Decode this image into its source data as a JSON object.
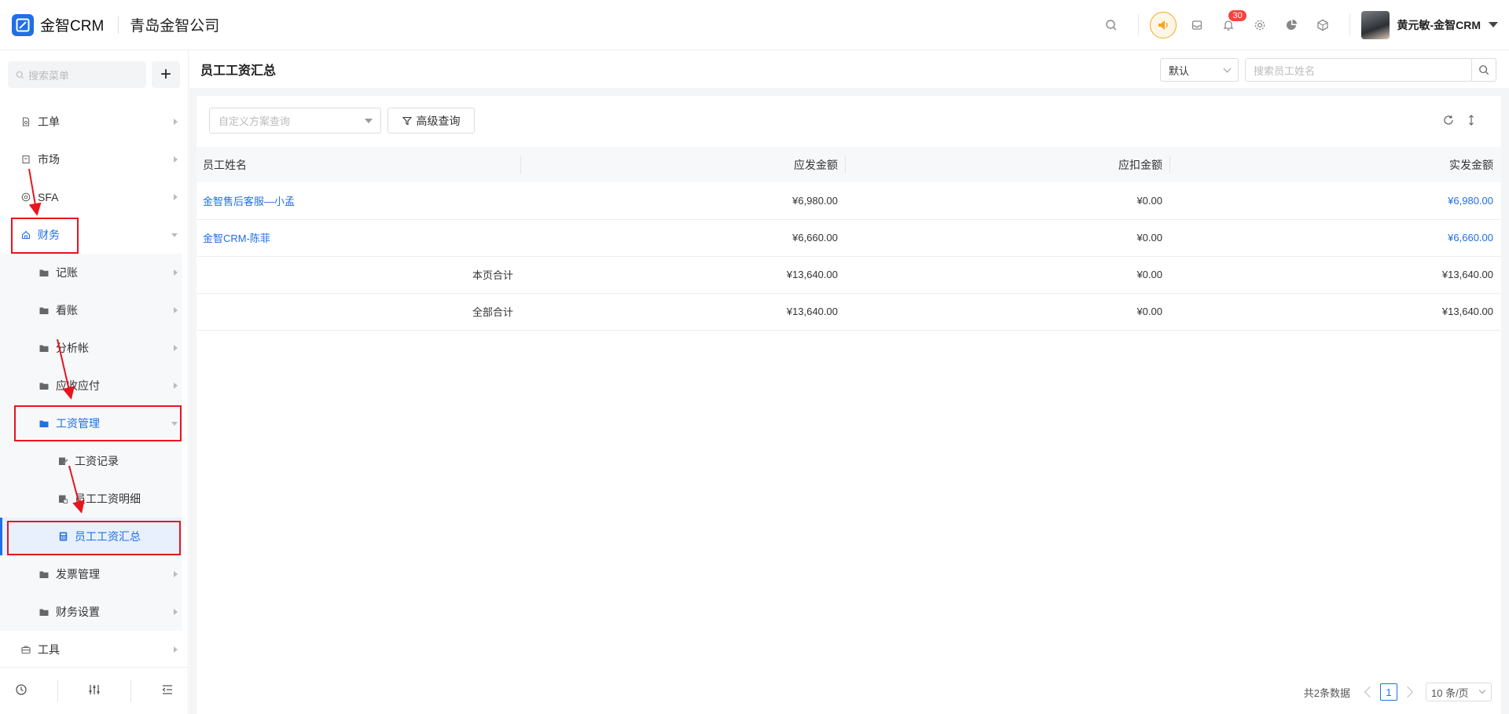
{
  "topbar": {
    "brand": "金智CRM",
    "company": "青岛金智公司",
    "notification_count": "30",
    "user_name": "黄元敏-金智CRM",
    "colors": {
      "accent": "#1f6fe5",
      "warning": "#f5a623",
      "badge": "#f5443c"
    }
  },
  "sidebar": {
    "search_placeholder": "搜索菜单",
    "add_label": "+",
    "items": [
      {
        "label": "工单",
        "icon": "document-icon"
      },
      {
        "label": "市场",
        "icon": "flag-icon"
      },
      {
        "label": "SFA",
        "icon": "target-icon"
      },
      {
        "label": "财务",
        "icon": "home-icon"
      },
      {
        "label": "记账",
        "icon": "folder-icon"
      },
      {
        "label": "看账",
        "icon": "folder-icon"
      },
      {
        "label": "分析帐",
        "icon": "folder-icon"
      },
      {
        "label": "应收应付",
        "icon": "folder-icon"
      },
      {
        "label": "工资管理",
        "icon": "folder-open-icon"
      },
      {
        "label": "工资记录",
        "icon": "edit-record-icon"
      },
      {
        "label": "员工工资明细",
        "icon": "detail-icon"
      },
      {
        "label": "员工工资汇总",
        "icon": "calculator-icon"
      },
      {
        "label": "发票管理",
        "icon": "folder-icon"
      },
      {
        "label": "财务设置",
        "icon": "folder-icon"
      },
      {
        "label": "工具",
        "icon": "toolbox-icon"
      }
    ]
  },
  "page": {
    "title": "员工工资汇总",
    "view_select": "默认",
    "employee_search_placeholder": "搜索员工姓名",
    "scheme_placeholder": "自定义方案查询",
    "advanced_query": "高级查询"
  },
  "table": {
    "columns": [
      "员工姓名",
      "应发金额",
      "应扣金额",
      "实发金额"
    ],
    "rows": [
      {
        "name": "金智售后客服—小孟",
        "gross": "¥6,980.00",
        "deduct": "¥0.00",
        "net": "¥6,980.00"
      },
      {
        "name": "金智CRM-陈菲",
        "gross": "¥6,660.00",
        "deduct": "¥0.00",
        "net": "¥6,660.00"
      }
    ],
    "page_total": {
      "label": "本页合计",
      "gross": "¥13,640.00",
      "deduct": "¥0.00",
      "net": "¥13,640.00"
    },
    "grand_total": {
      "label": "全部合计",
      "gross": "¥13,640.00",
      "deduct": "¥0.00",
      "net": "¥13,640.00"
    }
  },
  "pagination": {
    "total_text": "共2条数据",
    "current_page": "1",
    "page_size": "10 条/页"
  }
}
